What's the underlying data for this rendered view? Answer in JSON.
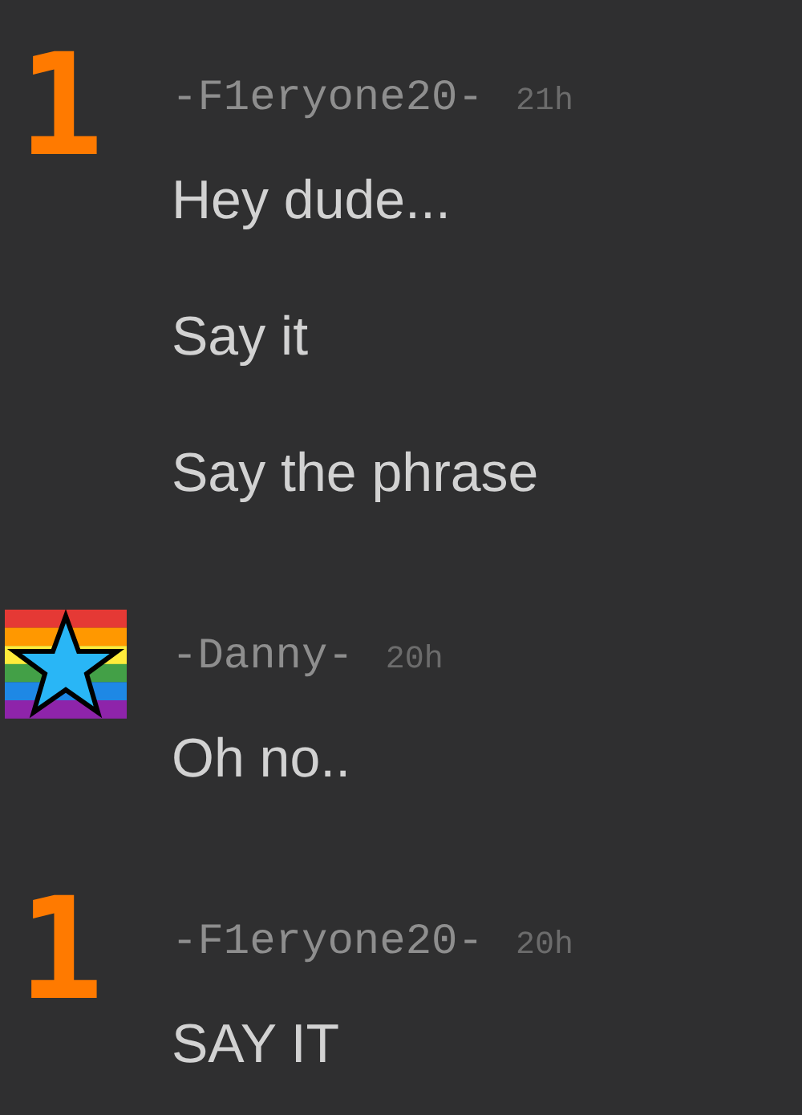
{
  "messages": [
    {
      "avatar": {
        "kind": "digit",
        "text": "1"
      },
      "user": "-F1eryone20-",
      "time": "21h",
      "lines": [
        "Hey dude...",
        "Say it",
        "Say the phrase"
      ]
    },
    {
      "avatar": {
        "kind": "star"
      },
      "user": "-Danny-",
      "time": "20h",
      "lines": [
        "Oh no.."
      ]
    },
    {
      "avatar": {
        "kind": "digit",
        "text": "1"
      },
      "user": "-F1eryone20-",
      "time": "20h",
      "lines": [
        "SAY IT"
      ]
    }
  ]
}
